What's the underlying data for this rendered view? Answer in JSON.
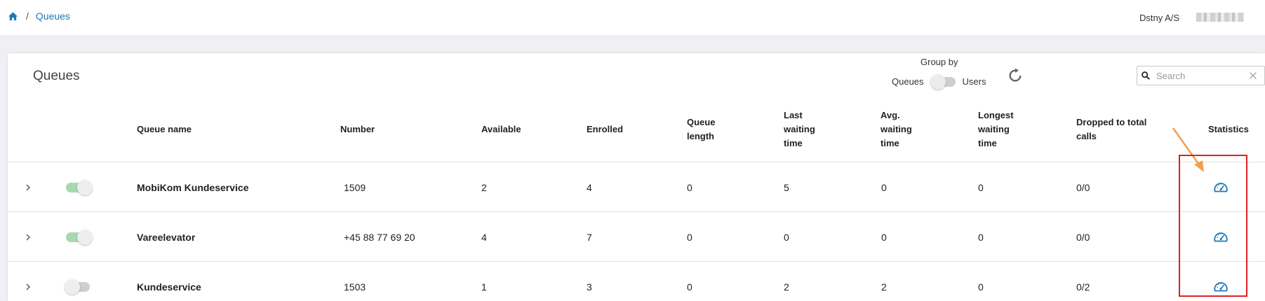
{
  "breadcrumb": {
    "separator": "/",
    "current": "Queues"
  },
  "header": {
    "company": "Dstny A/S"
  },
  "page": {
    "title": "Queues"
  },
  "group_by": {
    "label": "Group by",
    "left_option": "Queues",
    "right_option": "Users",
    "state": "queues"
  },
  "search": {
    "placeholder": "Search",
    "value": ""
  },
  "table": {
    "columns": {
      "queue_name": "Queue name",
      "number": "Number",
      "available": "Available",
      "enrolled": "Enrolled",
      "queue_length_1": "Queue",
      "queue_length_2": "length",
      "last_wait_1": "Last",
      "last_wait_2": "waiting",
      "last_wait_3": "time",
      "avg_wait_1": "Avg.",
      "avg_wait_2": "waiting",
      "avg_wait_3": "time",
      "longest_wait_1": "Longest",
      "longest_wait_2": "waiting",
      "longest_wait_3": "time",
      "dropped_1": "Dropped to total",
      "dropped_2": "calls",
      "statistics": "Statistics"
    },
    "rows": [
      {
        "enabled": true,
        "name": "MobiKom Kundeservice",
        "number": "1509",
        "available": "2",
        "enrolled": "4",
        "queue_length": "0",
        "last_wait": "5",
        "avg_wait": "0",
        "longest_wait": "0",
        "dropped": "0/0"
      },
      {
        "enabled": true,
        "name": "Vareelevator",
        "number": "+45 88 77 69 20",
        "available": "4",
        "enrolled": "7",
        "queue_length": "0",
        "last_wait": "0",
        "avg_wait": "0",
        "longest_wait": "0",
        "dropped": "0/0"
      },
      {
        "enabled": false,
        "name": "Kundeservice",
        "number": "1503",
        "available": "1",
        "enrolled": "3",
        "queue_length": "0",
        "last_wait": "2",
        "avg_wait": "2",
        "longest_wait": "0",
        "dropped": "0/2"
      }
    ]
  },
  "icons": {
    "home": "home-icon",
    "refresh": "refresh-icon",
    "search": "search-icon",
    "clear": "close-icon",
    "expand": "chevron-right-icon",
    "statistics": "speedometer-icon"
  },
  "colors": {
    "accent": "#1e78b4",
    "toggle_on": "#a9d8b0",
    "annotation": "#e02020",
    "arrow": "#f0a050"
  }
}
